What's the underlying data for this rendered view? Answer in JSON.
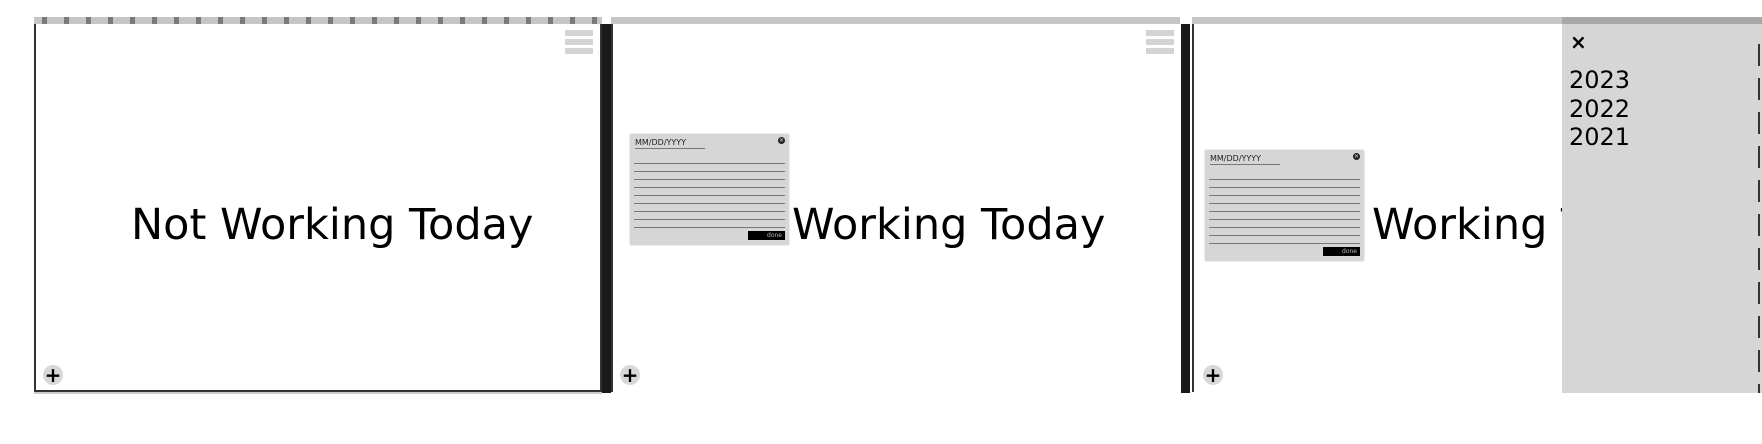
{
  "panels": [
    {
      "title": "Not Working Today"
    },
    {
      "title": "Working Today",
      "note": {
        "date_placeholder": "MM/DD/YYYY",
        "done_label": "done"
      }
    },
    {
      "title": "Working Today",
      "note": {
        "date_placeholder": "MM/DD/YYYY",
        "done_label": "done"
      }
    }
  ],
  "icons": {
    "menu": "hamburger-icon",
    "add": "plus-icon",
    "close": "close-icon"
  },
  "sidebar": {
    "close_label": "×",
    "years": [
      "2023",
      "2022",
      "2021"
    ]
  },
  "add_label": "+"
}
